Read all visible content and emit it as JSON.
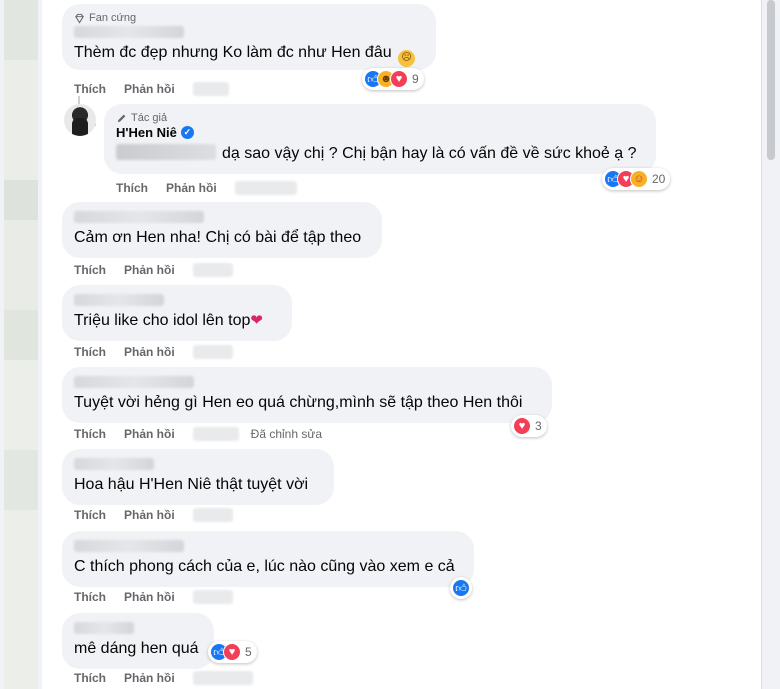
{
  "actions": {
    "like": "Thích",
    "reply": "Phản hồi",
    "edited": "Đã chỉnh sửa"
  },
  "comments": [
    {
      "badge": "Fan cứng",
      "text": "Thèm đc đẹp nhưng Ko làm đc như Hen đâu",
      "reaction_count": "9"
    },
    {
      "badge": "Tác giả",
      "author": "H'Hen Niê",
      "text": "dạ sao vậy chị ? Chị bận hay là có vấn đề về sức khoẻ ạ ?",
      "reaction_count": "20"
    },
    {
      "text": "Cảm ơn Hen nha! Chị có bài để tập theo"
    },
    {
      "text": "Triệu like cho idol lên top"
    },
    {
      "text": "Tuyệt vời hẻng gì Hen eo quá chừng,mình sẽ tập theo Hen thôi",
      "reaction_count": "3"
    },
    {
      "text": "Hoa hậu H'Hen Niê thật tuyệt vời"
    },
    {
      "text": "C thích phong cách của e, lúc nào cũng vào xem e cả"
    },
    {
      "text": "mê dáng hen quá",
      "reaction_count": "5"
    }
  ],
  "colors": {
    "bubble": "#f0f2f5",
    "like_blue": "#1877f2",
    "love_red": "#f33e58",
    "haha_yellow": "#f7b125"
  },
  "icons": [
    "diamond-icon",
    "pencil-icon",
    "verified-icon",
    "like-reaction-icon",
    "love-reaction-icon",
    "haha-reaction-icon",
    "care-reaction-icon",
    "heart-emoji-icon"
  ]
}
